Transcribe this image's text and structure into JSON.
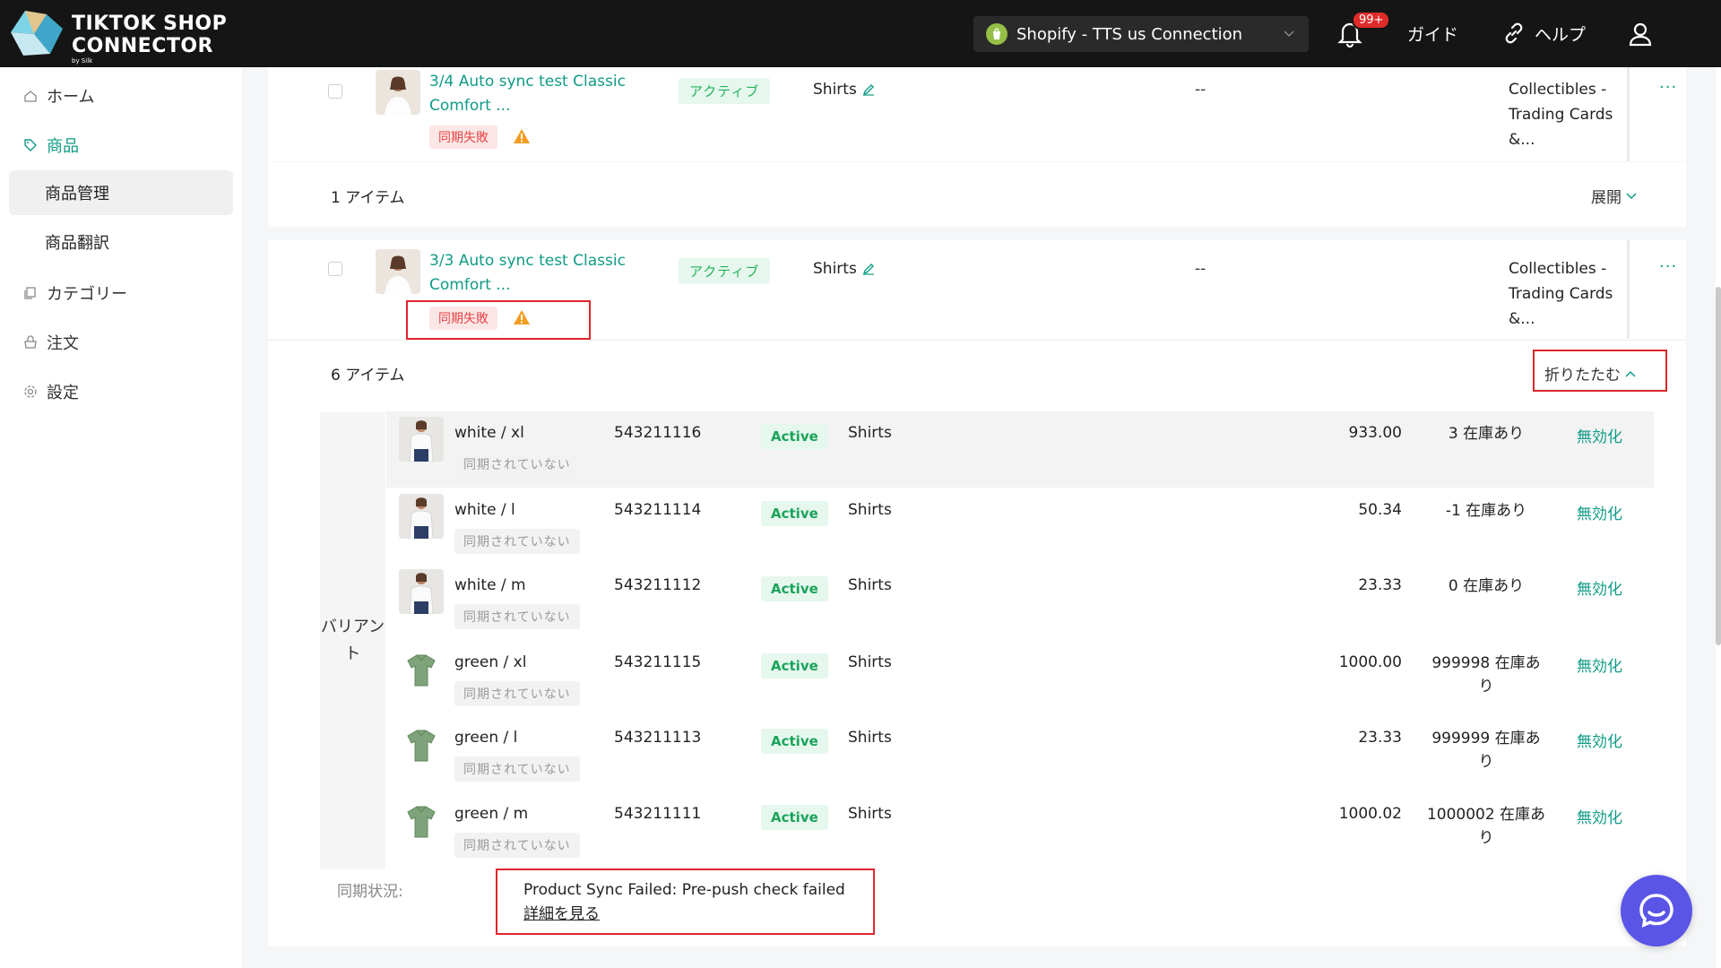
{
  "brand": {
    "line1": "TIKTOK SHOP",
    "line2": "CONNECTOR",
    "by": "by Silk"
  },
  "header": {
    "store_name": "Shopify - TTS us Connection",
    "notif_badge": "99+",
    "guide": "ガイド",
    "help": "ヘルプ"
  },
  "sidebar": {
    "home": "ホーム",
    "products": "商品",
    "product_mgmt": "商品管理",
    "product_translate": "商品翻訳",
    "category": "カテゴリー",
    "orders": "注文",
    "settings": "設定"
  },
  "products": [
    {
      "title": "3/4 Auto sync test Classic Comfort ...",
      "title_l1": "3/4 Auto sync test Classic",
      "title_l2": "Comfort ...",
      "fail_tag": "同期失敗",
      "status": "アクティブ",
      "category": "Shirts",
      "dash": "--",
      "collect_l1": "Collectibles -",
      "collect_l2": "Trading Cards &...",
      "more": "···",
      "items": "1 アイテム",
      "toggle": "展開"
    },
    {
      "title_l1": "3/3 Auto sync test Classic",
      "title_l2": "Comfort ...",
      "fail_tag": "同期失敗",
      "status": "アクティブ",
      "category": "Shirts",
      "dash": "--",
      "collect_l1": "Collectibles -",
      "collect_l2": "Trading Cards &...",
      "more": "···",
      "items": "6 アイテム",
      "toggle": "折りたたむ"
    }
  ],
  "variant_label_l1": "バリアン",
  "variant_label_l2": "ト",
  "variants": [
    {
      "name": "white / xl",
      "sync": "同期されていない",
      "sku": "543211116",
      "status": "Active",
      "category": "Shirts",
      "price": "933.00",
      "stock_l1": "3 在庫あり",
      "stock_l2": "",
      "action": "無効化",
      "color": "white"
    },
    {
      "name": "white / l",
      "sync": "同期されていない",
      "sku": "543211114",
      "status": "Active",
      "category": "Shirts",
      "price": "50.34",
      "stock_l1": "-1 在庫あり",
      "stock_l2": "",
      "action": "無効化",
      "color": "white"
    },
    {
      "name": "white / m",
      "sync": "同期されていない",
      "sku": "543211112",
      "status": "Active",
      "category": "Shirts",
      "price": "23.33",
      "stock_l1": "0 在庫あり",
      "stock_l2": "",
      "action": "無効化",
      "color": "white"
    },
    {
      "name": "green / xl",
      "sync": "同期されていない",
      "sku": "543211115",
      "status": "Active",
      "category": "Shirts",
      "price": "1000.00",
      "stock_l1": "999998 在庫あ",
      "stock_l2": "り",
      "action": "無効化",
      "color": "green"
    },
    {
      "name": "green / l",
      "sync": "同期されていない",
      "sku": "543211113",
      "status": "Active",
      "category": "Shirts",
      "price": "23.33",
      "stock_l1": "999999 在庫あ",
      "stock_l2": "り",
      "action": "無効化",
      "color": "green"
    },
    {
      "name": "green / m",
      "sync": "同期されていない",
      "sku": "543211111",
      "status": "Active",
      "category": "Shirts",
      "price": "1000.02",
      "stock_l1": "1000002 在庫あ",
      "stock_l2": "り",
      "action": "無効化",
      "color": "green"
    }
  ],
  "sync_status": {
    "label": "同期状況:",
    "message": "Product Sync Failed: Pre-push check failed",
    "link": "詳細を見る"
  },
  "colors": {
    "accent": "#0f9b86",
    "error": "#e0262c",
    "chat": "#5a55e6"
  }
}
